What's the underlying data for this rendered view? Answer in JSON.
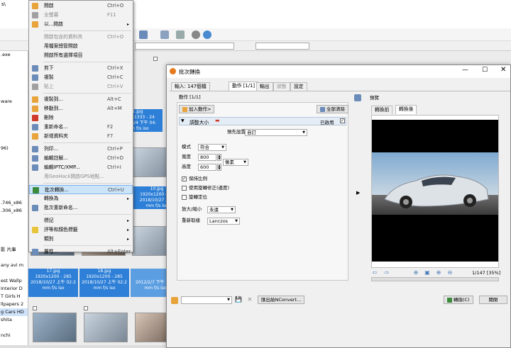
{
  "background": {
    "left_panel": [
      ".exe",
      "",
      "",
      "",
      "",
      "",
      "ware",
      "",
      "",
      "",
      "",
      "",
      "96)",
      "",
      "",
      "",
      "",
      "",
      "",
      ".746_x86",
      ".306_x86",
      "",
      "",
      "",
      "",
      "影 片庫",
      "",
      "any avi m",
      "",
      "est Wallp",
      "Interior D",
      "T Girls H",
      "llpapers 2",
      "g Cars HD",
      "shita",
      "",
      "nchi",
      "",
      "",
      "F"
    ],
    "left_panel_selected": 33,
    "captions": [
      {
        "name": "1.jpg",
        "size": "2000x1333 - 24",
        "date": "2012/6/4 下午 04:",
        "meta": "mm f/s iso"
      },
      {
        "name": "10.jpg",
        "size": "1920x1200 - 24",
        "date": "2018/10/27 上午",
        "meta": "mm f/s iso"
      },
      {
        "name": "17.jpg",
        "size": "1920x1200 - 285",
        "date": "2018/10/27 上午 02:2",
        "meta": "mm f/s iso"
      },
      {
        "name": "18.jpg",
        "size": "1920x1200 - 285",
        "date": "2018/10/27 上午 02:2",
        "meta": "mm f/s iso"
      },
      {
        "name": "",
        "size": "",
        "date": "2012/2/7 下午 01:1",
        "meta": "mm f/s iso"
      }
    ],
    "partial_top": "s\\"
  },
  "context_menu": {
    "items": [
      {
        "label": "開啟",
        "shortcut": "Ctrl+O",
        "arrow": "",
        "state": "normal",
        "icon_color": "#e8a33a",
        "icon": "open-icon"
      },
      {
        "label": "全螢幕",
        "shortcut": "F11",
        "arrow": "",
        "state": "disabled",
        "icon_color": "#a0a0a0",
        "icon": "fullscreen-icon"
      },
      {
        "label": "以...開啟",
        "shortcut": "",
        "arrow": "▸",
        "state": "normal",
        "icon_color": "#e8a33a",
        "icon": "open-with-icon"
      },
      {
        "label": "開啟包含的資料夾",
        "shortcut": "Ctrl+O",
        "arrow": "",
        "state": "disabled",
        "icon_color": "",
        "icon": ""
      },
      {
        "label": "用檔案總管開啟",
        "shortcut": "",
        "arrow": "",
        "state": "normal",
        "icon_color": "",
        "icon": ""
      },
      {
        "label": "開啟所有選擇項目",
        "shortcut": "",
        "arrow": "",
        "state": "normal",
        "icon_color": "",
        "icon": ""
      },
      {
        "label": "剪下",
        "shortcut": "Ctrl+X",
        "arrow": "",
        "state": "normal",
        "icon_color": "#6b8bb8",
        "icon": "cut-icon"
      },
      {
        "label": "複製",
        "shortcut": "Ctrl+C",
        "arrow": "",
        "state": "normal",
        "icon_color": "#6b8bb8",
        "icon": "copy-icon"
      },
      {
        "label": "貼上",
        "shortcut": "Ctrl+V",
        "arrow": "",
        "state": "disabled",
        "icon_color": "#a0a0a0",
        "icon": "paste-icon"
      },
      {
        "label": "複製到...",
        "shortcut": "Alt+C",
        "arrow": "",
        "state": "normal",
        "icon_color": "#e8a33a",
        "icon": "copy-to-icon"
      },
      {
        "label": "移動到...",
        "shortcut": "Alt+M",
        "arrow": "",
        "state": "normal",
        "icon_color": "#e8a33a",
        "icon": "move-to-icon"
      },
      {
        "label": "刪除",
        "shortcut": "",
        "arrow": "",
        "state": "normal",
        "icon_color": "#d03a2a",
        "icon": "delete-icon"
      },
      {
        "label": "重新命名...",
        "shortcut": "F2",
        "arrow": "",
        "state": "normal",
        "icon_color": "#6b8bb8",
        "icon": "rename-icon"
      },
      {
        "label": "新增資料夾",
        "shortcut": "F7",
        "arrow": "",
        "state": "normal",
        "icon_color": "#e8a33a",
        "icon": "new-folder-icon"
      },
      {
        "label": "列印...",
        "shortcut": "Ctrl+P",
        "arrow": "",
        "state": "normal",
        "icon_color": "#6b8bb8",
        "icon": "print-icon"
      },
      {
        "label": "編輯註解...",
        "shortcut": "Ctrl+D",
        "arrow": "",
        "state": "normal",
        "icon_color": "#6b8bb8",
        "icon": "comment-icon"
      },
      {
        "label": "編輯IPTC/XMP...",
        "shortcut": "Ctrl+I",
        "arrow": "",
        "state": "normal",
        "icon_color": "#6b8bb8",
        "icon": "iptc-icon"
      },
      {
        "label": "用GeoHack開啟GPS地點...",
        "shortcut": "",
        "arrow": "",
        "state": "disabled",
        "icon_color": "",
        "icon": ""
      },
      {
        "label": "批次轉換...",
        "shortcut": "Ctrl+U",
        "arrow": "",
        "state": "highlighted",
        "icon_color": "#3b8a3b",
        "icon": "batch-convert-icon"
      },
      {
        "label": "轉換為",
        "shortcut": "",
        "arrow": "▸",
        "state": "normal",
        "icon_color": "",
        "icon": ""
      },
      {
        "label": "批次重新命名...",
        "shortcut": "",
        "arrow": "",
        "state": "normal",
        "icon_color": "#6b8bb8",
        "icon": "batch-rename-icon"
      },
      {
        "label": "標記",
        "shortcut": "",
        "arrow": "▸",
        "state": "normal",
        "icon_color": "",
        "icon": ""
      },
      {
        "label": "評等和顏色標籤",
        "shortcut": "",
        "arrow": "▸",
        "state": "normal",
        "icon_color": "#e8c43a",
        "icon": "rating-icon"
      },
      {
        "label": "類別",
        "shortcut": "",
        "arrow": "▸",
        "state": "normal",
        "icon_color": "",
        "icon": ""
      },
      {
        "label": "屬性...",
        "shortcut": "Alt+Enter",
        "arrow": "",
        "state": "normal",
        "icon_color": "#6b8bb8",
        "icon": "properties-icon"
      }
    ]
  },
  "dialog": {
    "title": "批次轉換",
    "tabs": [
      "輸入: 147個檔",
      "動作 [1/1]",
      "輸出",
      "狀態",
      "設定"
    ],
    "actions_header": "動作 [1/1]",
    "add_action": "加入動作>",
    "clear_all": "全部清除",
    "action_name": "調整大小",
    "enabled_label": "已啟用",
    "preset_label": "預先設置",
    "preset_value": "自訂",
    "mode_label": "模式",
    "mode_value": "符合",
    "width_label": "寬度",
    "width_value": "800",
    "height_label": "高度",
    "height_value": "600",
    "unit_value": "像素",
    "keep_ratio": "保持比例",
    "use_orientation": "使用旋轉修正(邊度)",
    "rotate_fix": "旋轉定位",
    "enlarge_label": "放大/縮小",
    "enlarge_value": "永遠",
    "resample_label": "重新取樣",
    "resample_value": "Lanczos",
    "preview_label": "預覽",
    "preview_tabs": [
      "轉換前",
      "轉換後"
    ],
    "preview_counter": "1/147 [35%]",
    "export_nconvert": "匯出給NConvert...",
    "convert_button": "轉換(C)",
    "close_button": "關閉",
    "preview_colors": {
      "sky": "#8db6d9",
      "car": "#dfe3e8",
      "road": "#4a4a4a"
    }
  }
}
